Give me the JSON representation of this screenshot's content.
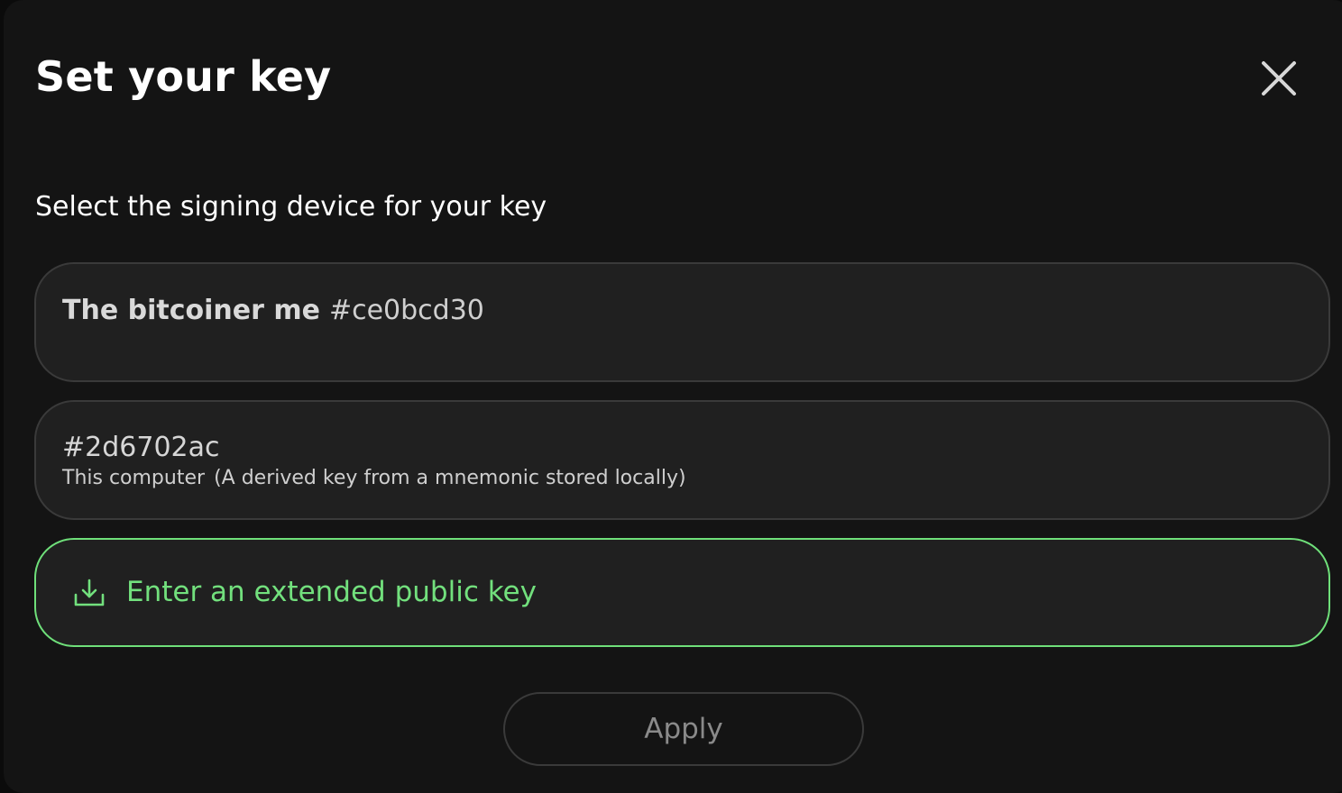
{
  "modal": {
    "title": "Set your key",
    "subtitle": "Select the signing device for your key"
  },
  "devices": [
    {
      "alias": "The bitcoiner me",
      "fingerprint": "#ce0bcd30"
    },
    {
      "fingerprint": "#2d6702ac",
      "kind": "This computer",
      "note": "(A derived key from a mnemonic stored locally)"
    }
  ],
  "xpub_option": {
    "label": "Enter an extended public key",
    "icon": "download-icon",
    "accent": "#72e07d"
  },
  "apply_label": "Apply",
  "icons": {
    "close": "close-icon"
  }
}
